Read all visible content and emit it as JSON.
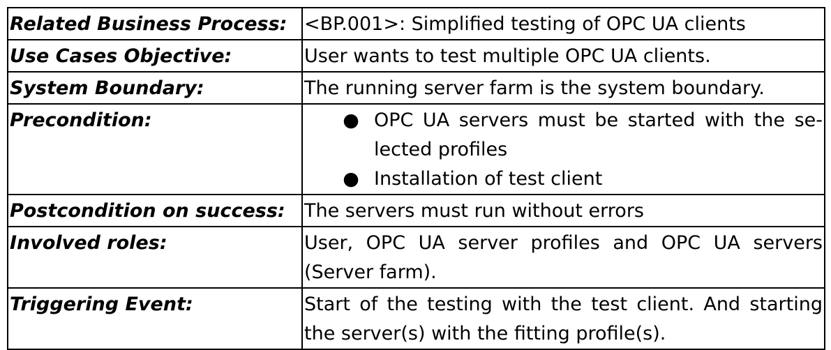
{
  "table": {
    "rows": [
      {
        "label": "Related Business Process:",
        "value": "<BP.001>: Simplified testing of OPC UA clients"
      },
      {
        "label": "Use Cases Objective:",
        "value": "User wants to test multiple OPC UA clients."
      },
      {
        "label": "System Boundary:",
        "value": "The running server farm is the system boundary."
      },
      {
        "label": "Precondition:",
        "items": [
          "OPC UA servers must be started with the se­lected profiles",
          "Installation of test client"
        ]
      },
      {
        "label": "Postcondition on success:",
        "value": "The servers must run without errors"
      },
      {
        "label": "Involved roles:",
        "value": "User, OPC UA server profiles and OPC UA servers (Server farm)."
      },
      {
        "label": "Triggering Event:",
        "value": "Start of the testing with the test client. And starting the server(s) with the fitting profile(s)."
      }
    ]
  }
}
